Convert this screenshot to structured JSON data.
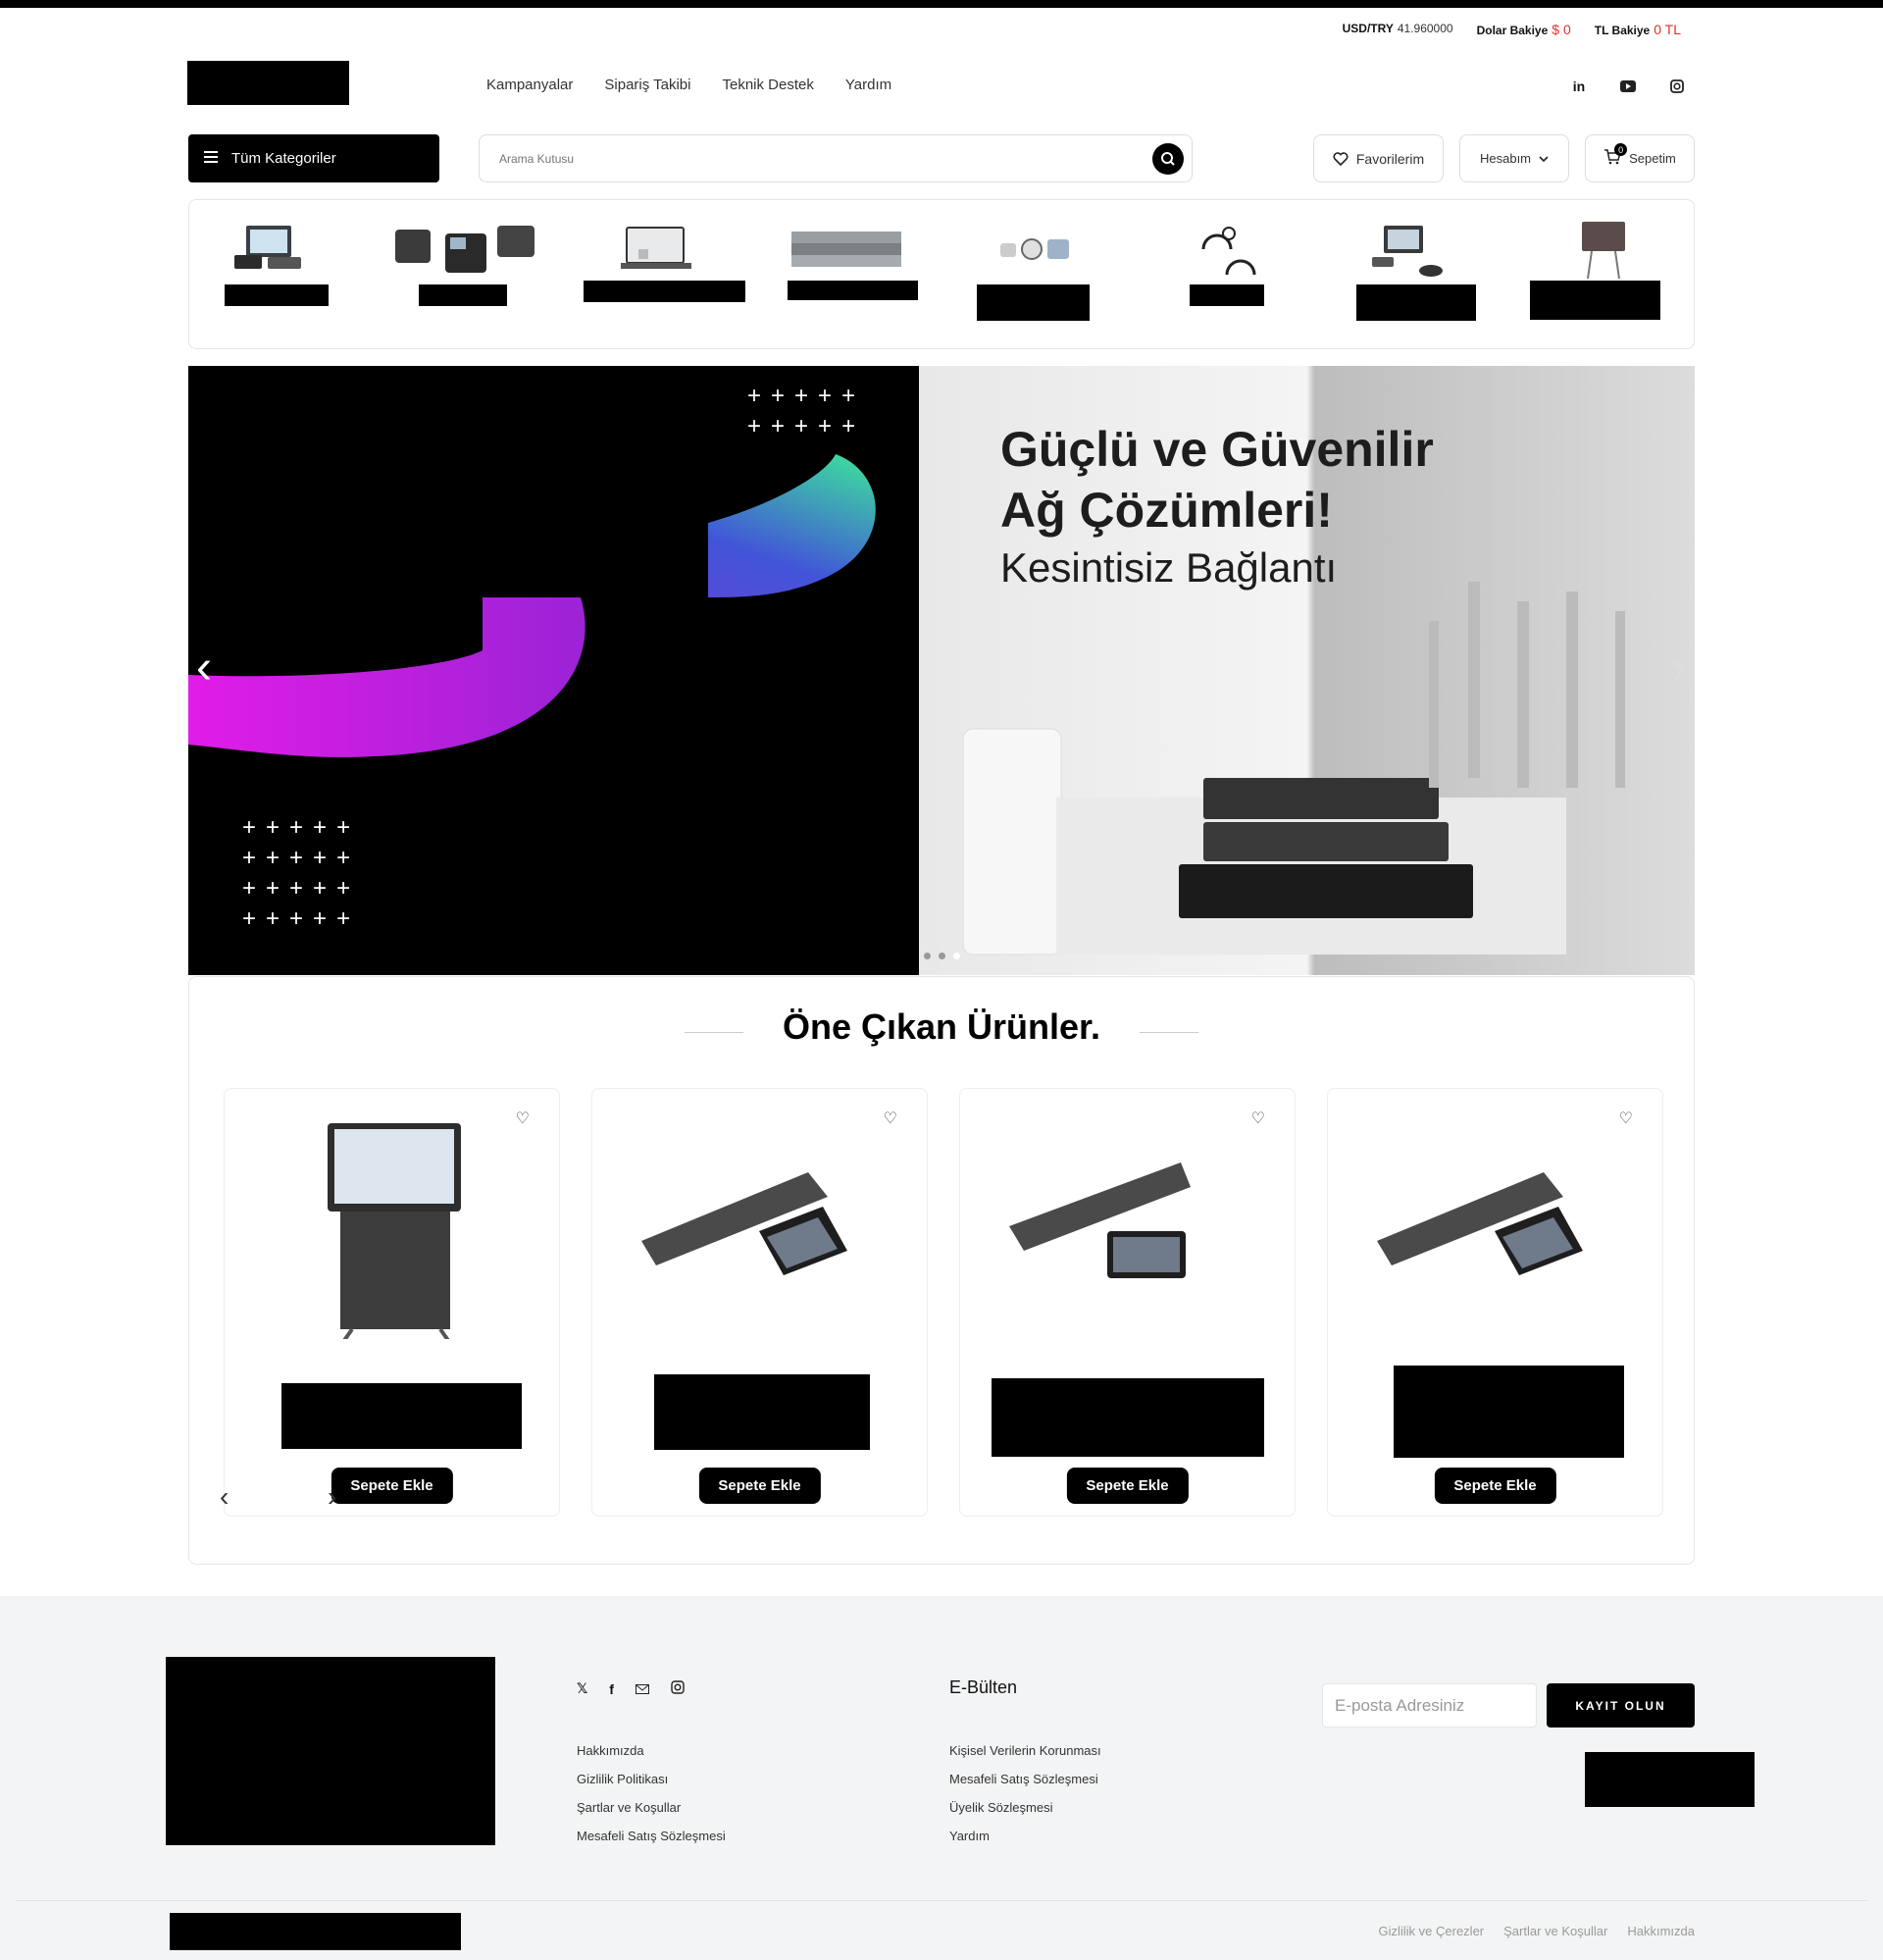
{
  "rates": {
    "usd_label": "USD/TRY",
    "usd_value": "41.960000",
    "dollar_label": "Dolar Bakiye",
    "dollar_value": "$ 0",
    "tl_label": "TL Bakiye",
    "tl_value": "0 TL"
  },
  "nav": [
    "Kampanyalar",
    "Sipariş Takibi",
    "Teknik Destek",
    "Yardım"
  ],
  "social_icons": [
    "linkedin-icon",
    "youtube-icon",
    "instagram-icon"
  ],
  "categories_button": "Tüm Kategoriler",
  "search": {
    "placeholder": "Arama Kutusu"
  },
  "header_buttons": {
    "favorites": "Favorilerim",
    "account": "Hesabım",
    "cart": "Sepetim",
    "cart_count": "0"
  },
  "category_icons": [
    "pbx-system",
    "ip-phones",
    "voip-gateway",
    "rack-server",
    "security-cameras",
    "headsets",
    "video-conference",
    "interactive-display"
  ],
  "hero": {
    "title_line1": "Güçlü ve Güvenilir",
    "title_line2": "Ağ Çözümleri!",
    "subtitle": "Kesintisiz Bağlantı",
    "slides": 3,
    "active_slide": 3
  },
  "featured": {
    "title": "Öne Çıkan Ürünler.",
    "add_to_cart": "Sepete Ekle"
  },
  "footer": {
    "ebulten": "E-Bülten",
    "email_placeholder": "E-posta Adresiniz",
    "subscribe": "KAYIT OLUN",
    "col1": [
      "Hakkımızda",
      "Gizlilik Politikası",
      "Şartlar ve Koşullar",
      "Mesafeli Satış Sözleşmesi"
    ],
    "col2": [
      "Kişisel Verilerin Korunması",
      "Mesafeli Satış Sözleşmesi",
      "Üyelik Sözleşmesi",
      "Yardım"
    ],
    "bottom_links": [
      "Gizlilik ve Çerezler",
      "Şartlar ve Koşullar",
      "Hakkımızda"
    ]
  },
  "colors": {
    "accent_red": "#e0312b",
    "primary": "#000000",
    "footer_bg": "#f3f4f5"
  }
}
